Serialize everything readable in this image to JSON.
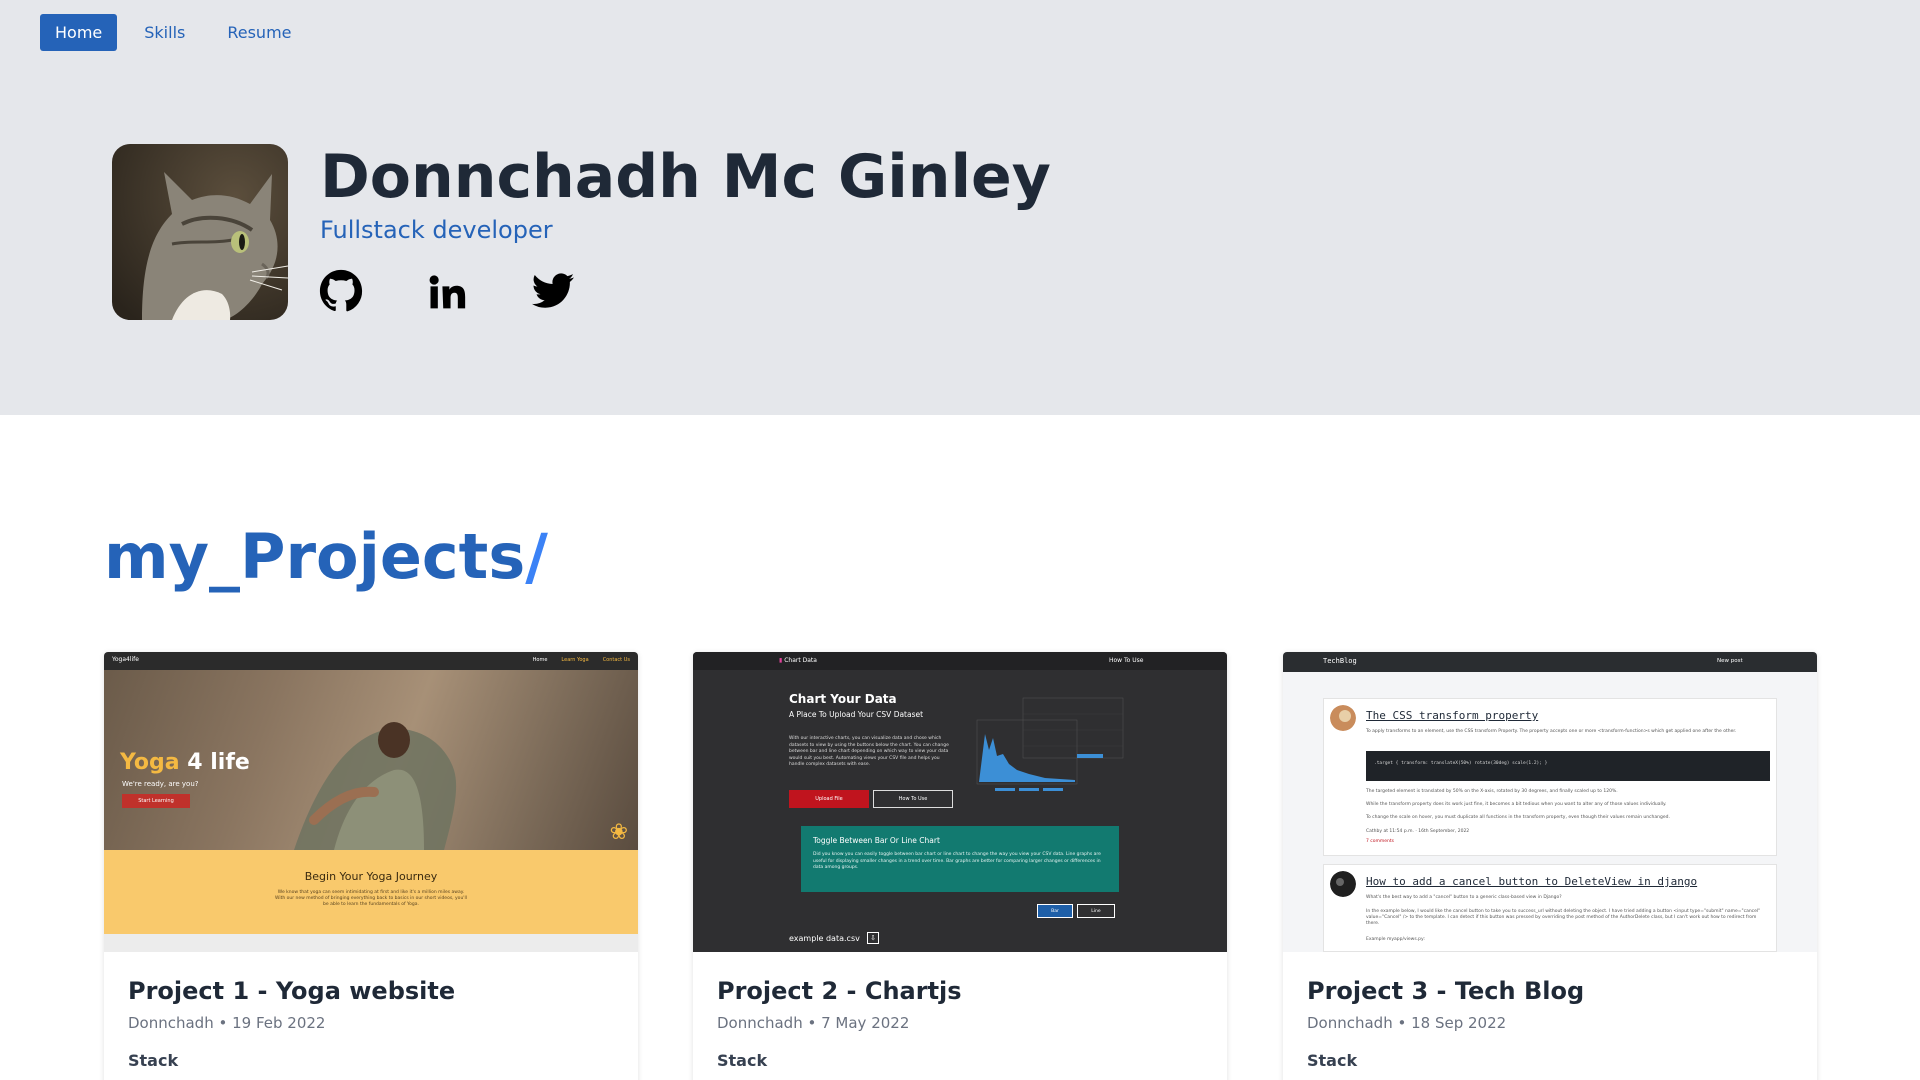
{
  "nav": {
    "items": [
      {
        "label": "Home",
        "active": true
      },
      {
        "label": "Skills",
        "active": false
      },
      {
        "label": "Resume",
        "active": false
      }
    ]
  },
  "profile": {
    "name": "Donnchadh Mc Ginley",
    "role": "Fullstack developer",
    "socials": [
      "github-icon",
      "linkedin-icon",
      "twitter-icon"
    ]
  },
  "projects": {
    "title": "my_Projects",
    "title_slash": "/",
    "cards": [
      {
        "title": "Project 1 - Yoga website",
        "meta": "Donnchadh • 19 Feb 2022",
        "stack_label": "Stack",
        "preview": {
          "logo": "Yoga4life",
          "links": [
            "Home",
            "Learn Yoga",
            "Contact Us"
          ],
          "heading_highlight": "Yoga",
          "heading_rest": " 4 life",
          "subheading": "We're ready, are you?",
          "button": "Start Learning",
          "section_title": "Begin Your Yoga Journey",
          "section_text": "We know that yoga can seem intimidating at first and like it's a million miles away. With our new method of bringing everything back to basics in our short videos, you'll be able to learn the fundamentals of Yoga."
        }
      },
      {
        "title": "Project 2 - Chartjs",
        "meta": "Donnchadh • 7 May 2022",
        "stack_label": "Stack",
        "preview": {
          "logo": "Chart Data",
          "nav_link": "How To Use",
          "heading": "Chart Your Data",
          "subheading": "A Place To Upload Your CSV Dataset",
          "paragraph": "With our interactive charts, you can visualize data and chose which datasets to view by using the buttons below the chart. You can change between bar and line chart depending on which way to view your data would suit you best. Automating views your CSV file and helps you handle complex datasets with ease.",
          "upload_button": "Upload File",
          "howto_button": "How To Use",
          "panel_title": "Toggle Between Bar Or Line Chart",
          "panel_text": "Did you know you can easily toggle between bar chart or line chart to change the way you view your CSV data. Line graphs are useful for displaying smaller changes in a trend over time. Bar graphs are better for comparing larger changes or differences in data among groups.",
          "bar_button": "Bar",
          "line_button": "Line",
          "example_file": "example data.csv"
        }
      },
      {
        "title": "Project 3 - Tech Blog",
        "meta": "Donnchadh • 18 Sep 2022",
        "stack_label": "Stack",
        "preview": {
          "logo": "TechBlog",
          "new_post": "New post",
          "post1_title": "The CSS transform property",
          "post1_text": "To apply transforms to an element, use the CSS transform Property. The property accepts one or more <transform-function>s which get applied one after the other.",
          "post1_code": ".target { transform: translateX(50%) rotate(30deg) scale(1.2); }",
          "post1_text2": "The targeted element is translated by 50% on the X-axis, rotated by 30 degrees, and finally scaled up to 120%.",
          "post1_text3": "While the transform property does its work just fine, it becomes a bit tedious when you want to alter any of those values individually.",
          "post1_text4": "To change the scale on hover, you must duplicate all functions in the transform property, even though their values remain unchanged.",
          "post1_meta": "Cathby at 11:54 p.m. · 16th September, 2022",
          "post1_comments": "7 comments",
          "post2_title": "How to add a cancel button to DeleteView in django",
          "post2_text": "What's the best way to add a \"cancel\" button to a generic class-based view in Django?",
          "post2_text2": "In the example below, I would like the cancel button to take you to success_url without deleting the object. I have tried adding a button <input type=\"submit\" name=\"cancel\" value=\"Cancel\" /> to the template. I can detect if this button was pressed by overriding the post method of the AuthorDelete class, but I can't work out how to redirect from there.",
          "post2_text3": "Example myapp/views.py:"
        }
      }
    ]
  },
  "colors": {
    "accent": "#2563b8",
    "hero_bg": "#e5e7eb",
    "text": "#1f2937"
  }
}
